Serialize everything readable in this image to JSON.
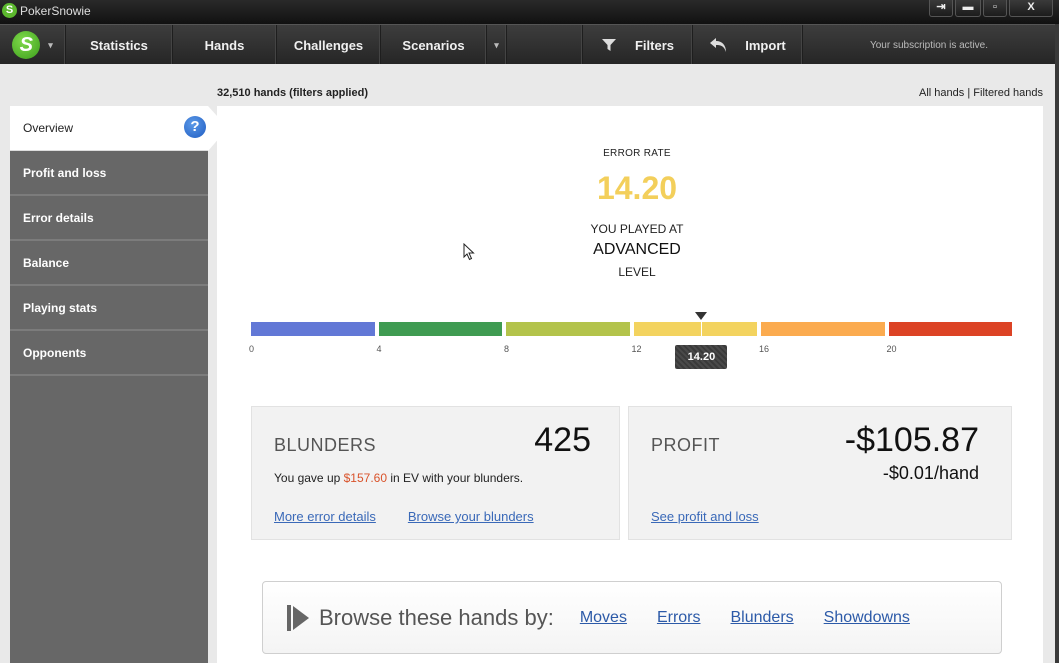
{
  "window": {
    "title": "PokerSnowie",
    "app_icon_letter": "S",
    "controls": {
      "exit": "⇥",
      "minimize": "▬",
      "maximize": "▫",
      "close": "X"
    }
  },
  "toolbar": {
    "logo_letter": "S",
    "menu_caret": "▾",
    "items": [
      {
        "label": "Statistics"
      },
      {
        "label": "Hands"
      },
      {
        "label": "Challenges"
      },
      {
        "label": "Scenarios"
      }
    ],
    "more_caret": "▾",
    "filters_label": "Filters",
    "import_label": "Import",
    "subscription_status": "Your subscription is active."
  },
  "header": {
    "hands_count": "32,510 hands (filters applied)",
    "toggle_all": "All hands",
    "toggle_sep": " | ",
    "toggle_filtered": "Filtered hands"
  },
  "sidebar": {
    "items": [
      {
        "label": "Overview",
        "active": true
      },
      {
        "label": "Profit and loss"
      },
      {
        "label": "Error details"
      },
      {
        "label": "Balance"
      },
      {
        "label": "Playing stats"
      },
      {
        "label": "Opponents"
      }
    ],
    "help_glyph": "?"
  },
  "error_rate": {
    "label": "ERROR RATE",
    "value": "14.20",
    "value_num": 14.2,
    "played_at": "YOU PLAYED AT",
    "level": "ADVANCED",
    "level_word": "LEVEL",
    "value_color": "#f3cf5b",
    "scale": {
      "min": 0,
      "max": 24,
      "ticks": [
        "0",
        "4",
        "8",
        "12",
        "16",
        "20"
      ],
      "segment_colors": [
        "#6278d6",
        "#3f9b52",
        "#b3c34b",
        "#f3d35f",
        "#fbab4f",
        "#dc4325"
      ],
      "marker_label": "14.20"
    }
  },
  "blunders": {
    "title": "BLUNDERS",
    "count": "425",
    "text_before": "You gave up ",
    "ev_amount": "$157.60",
    "text_after": " in EV with your blunders.",
    "link_details": "More error details",
    "link_browse": "Browse your blunders"
  },
  "profit": {
    "title": "PROFIT",
    "amount": "-$105.87",
    "per_hand": "-$0.01/hand",
    "link": "See profit and loss"
  },
  "browse": {
    "title": "Browse these hands by:",
    "links": [
      "Moves",
      "Errors",
      "Blunders",
      "Showdowns"
    ]
  }
}
